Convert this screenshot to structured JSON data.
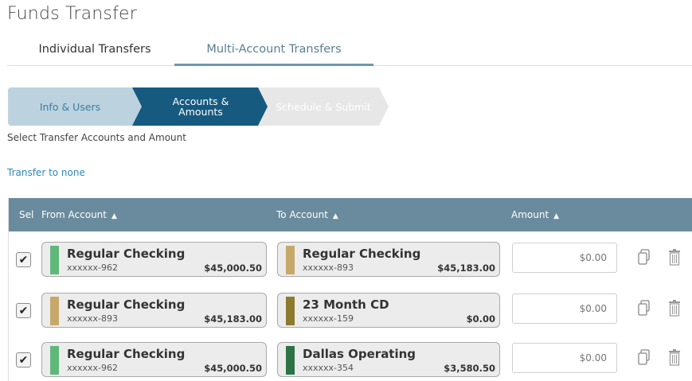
{
  "page": {
    "title": "Funds Transfer"
  },
  "tabs": [
    {
      "label": "Individual Transfers",
      "active": false
    },
    {
      "label": "Multi-Account Transfers",
      "active": true
    }
  ],
  "wizard": [
    {
      "label": "Info & Users",
      "state": "complete"
    },
    {
      "label": "Accounts &\nAmounts",
      "state": "active"
    },
    {
      "label": "Schedule & Submit",
      "state": "pending"
    }
  ],
  "subtitle": "Select Transfer Accounts and Amount",
  "transfer_link": "Transfer to none",
  "grid": {
    "headers": {
      "sel": "Sel",
      "from": "From Account",
      "to": "To Account",
      "amount": "Amount"
    },
    "header_color": "#6a8b9d",
    "rows": [
      {
        "selected": true,
        "from": {
          "name": "Regular Checking",
          "number": "xxxxxx-962",
          "balance": "$45,000.50",
          "color": "#5fb87a"
        },
        "to": {
          "name": "Regular Checking",
          "number": "xxxxxx-893",
          "balance": "$45,183.00",
          "color": "#c6a96a"
        },
        "amount_placeholder": "$0.00"
      },
      {
        "selected": true,
        "from": {
          "name": "Regular Checking",
          "number": "xxxxxx-893",
          "balance": "$45,183.00",
          "color": "#c6a96a"
        },
        "to": {
          "name": "23 Month CD",
          "number": "xxxxxx-159",
          "balance": "$0.00",
          "color": "#8c7a2e"
        },
        "amount_placeholder": "$0.00"
      },
      {
        "selected": true,
        "from": {
          "name": "Regular Checking",
          "number": "xxxxxx-962",
          "balance": "$45,000.50",
          "color": "#5fb87a"
        },
        "to": {
          "name": "Dallas Operating",
          "number": "xxxxxx-354",
          "balance": "$3,580.50",
          "color": "#2e7346"
        },
        "amount_placeholder": "$0.00"
      }
    ]
  },
  "icons": {
    "check": "checkmark-icon",
    "copy": "copy-icon",
    "delete": "trash-icon",
    "sort": "sort-up-caret-icon"
  }
}
